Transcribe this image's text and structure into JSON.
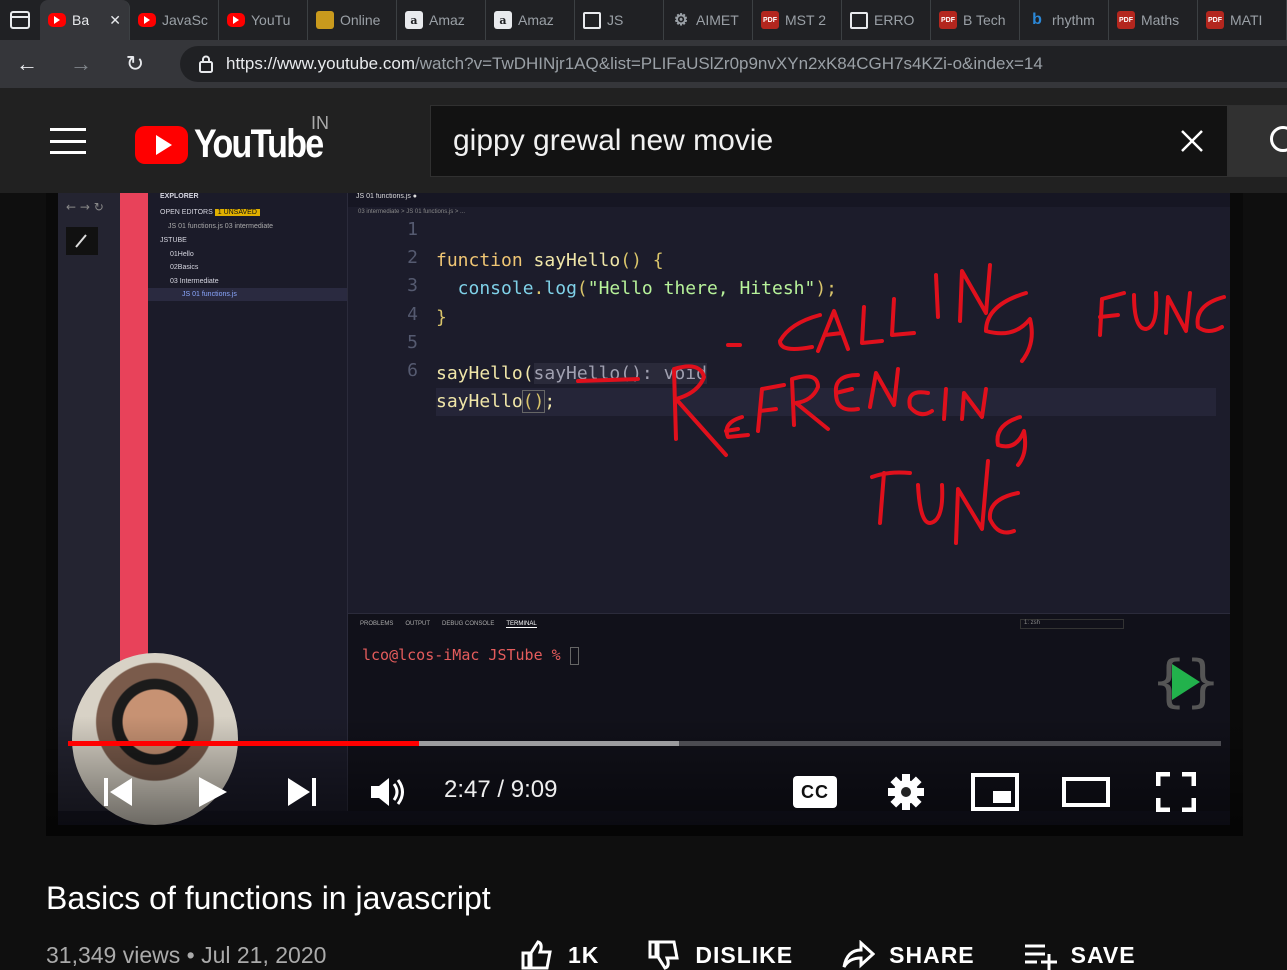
{
  "browser": {
    "tabs": [
      {
        "label": "Ba",
        "favicon": "youtube-icon",
        "active": true
      },
      {
        "label": "JavaSc",
        "favicon": "youtube-icon"
      },
      {
        "label": "YouTu",
        "favicon": "youtube-icon"
      },
      {
        "label": "Online",
        "favicon": "online-icon"
      },
      {
        "label": "Amaz",
        "favicon": "amazon-icon"
      },
      {
        "label": "Amaz",
        "favicon": "amazon-icon"
      },
      {
        "label": "JS",
        "favicon": "document-icon"
      },
      {
        "label": "AIMET",
        "favicon": "gear-icon"
      },
      {
        "label": "MST 2",
        "favicon": "pdf-icon"
      },
      {
        "label": "ERRO",
        "favicon": "document-icon"
      },
      {
        "label": "B Tech",
        "favicon": "pdf-icon"
      },
      {
        "label": "rhythm",
        "favicon": "bing-icon"
      },
      {
        "label": "Maths",
        "favicon": "pdf-icon"
      },
      {
        "label": "MATI",
        "favicon": "pdf-icon"
      }
    ],
    "url_host": "https://www.youtube.com",
    "url_path": "/watch?v=TwDHINjr1AQ&list=PLIFaUSlZr0p9nvXYn2xK84CGH7s4KZi-o&index=14"
  },
  "youtube": {
    "logo_text": "YouTube",
    "country_code": "IN",
    "search_value": "gippy grewal new movie"
  },
  "video": {
    "editor": {
      "explorer_title": "EXPLORER",
      "open_editors": "OPEN EDITORS",
      "unsaved_badge": "1 UNSAVED",
      "open_file": "JS  01 functions.js  03 intermediate",
      "project": "JSTUBE",
      "folders": [
        "01Hello",
        "02Basics",
        "03 Intermediate"
      ],
      "file": "JS  01 functions.js",
      "tab_title": "JS  01 functions.js  ●",
      "breadcrumb": "03 intermediate  >  JS  01 functions.js  >  ...",
      "line_numbers": [
        "1",
        "2",
        "3",
        "4",
        "5",
        "6"
      ],
      "panel_tabs": [
        "PROBLEMS",
        "OUTPUT",
        "DEBUG CONSOLE",
        "TERMINAL"
      ],
      "terminal_shell": "1: zsh",
      "terminal_prompt": "lco@lcos-iMac JSTube %"
    },
    "code": {
      "l1_kw": "function",
      "l1_name": " sayHello",
      "l1_rest": "() {",
      "l2_obj": "  console",
      "l2_dot": ".",
      "l2_fn": "log",
      "l2_p1": "(",
      "l2_str": "\"Hello there, Hitesh\"",
      "l2_p2": ");",
      "l3": "}",
      "l5_call": "sayHello(",
      "l5_hint": "sayHello(): void",
      "l6_call": "sayHello",
      "l6_paren": "()",
      "l6_semi": ";"
    },
    "annotations": [
      "- CALLING FUNC",
      "- REFRENCING FUNC"
    ],
    "player": {
      "current_time": "2:47",
      "duration": "9:09",
      "time_display": "2:47 / 9:09",
      "played_fraction": 0.304,
      "buffered_fraction": 0.53,
      "cc_label": "CC"
    }
  },
  "watch": {
    "title": "Basics of functions in javascript",
    "meta": "31,349 views • Jul 21, 2020",
    "like_label": "1K",
    "dislike_label": "DISLIKE",
    "share_label": "SHARE",
    "save_label": "SAVE"
  },
  "colors": {
    "yt_red": "#ff0000",
    "annotation_red": "#e0101c",
    "editor_accent": "#e8425a"
  }
}
